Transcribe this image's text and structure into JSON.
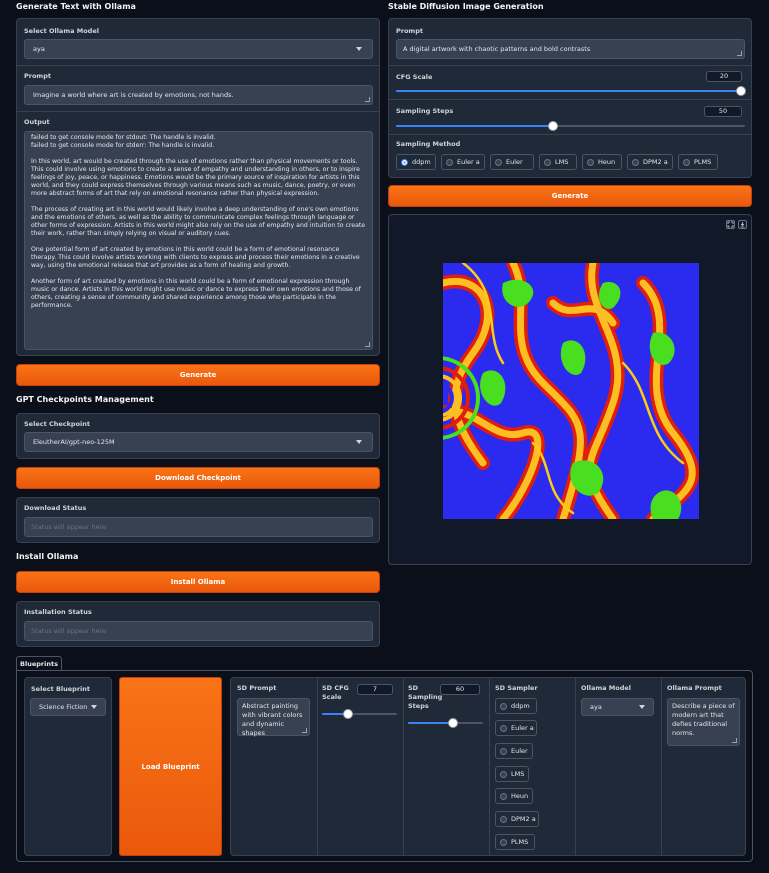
{
  "left": {
    "title": "Generate Text with Ollama",
    "model_label": "Select Ollama Model",
    "model_value": "aya",
    "prompt_label": "Prompt",
    "prompt_value": "Imagine a world where art is created by emotions, not hands.",
    "output_label": "Output",
    "output_text": "failed to get console mode for stdout: The handle is invalid.\nfailed to get console mode for stderr: The handle is invalid.\n\nIn this world, art would be created through the use of emotions rather than physical movements or tools. This could involve using emotions to create a sense of empathy and understanding in others, or to inspire feelings of joy, peace, or happiness. Emotions would be the primary source of inspiration for artists in this world, and they could express themselves through various means such as music, dance, poetry, or even more abstract forms of art that rely on emotional resonance rather than physical expression.\n\nThe process of creating art in this world would likely involve a deep understanding of one's own emotions and the emotions of others, as well as the ability to communicate complex feelings through language or other forms of expression. Artists in this world might also rely on the use of empathy and intuition to create their work, rather than simply relying on visual or auditory cues.\n\nOne potential form of art created by emotions in this world could be a form of emotional resonance therapy. This could involve artists working with clients to express and process their emotions in a creative way, using the emotional release that art provides as a form of healing and growth.\n\nAnother form of art created by emotions in this world could be a form of emotional expression through music or dance. Artists in this world might use music or dance to express their own emotions and those of others, creating a sense of community and shared experience among those who participate in the performance.",
    "generate_label": "Generate",
    "ckpt_title": "GPT Checkpoints Management",
    "ckpt_label": "Select Checkpoint",
    "ckpt_value": "EleutherAI/gpt-neo-125M",
    "download_label": "Download Checkpoint",
    "download_status_label": "Download Status",
    "download_status_placeholder": "Status will appear here",
    "install_title": "Install Ollama",
    "install_label": "Install Ollama",
    "install_status_label": "Installation Status",
    "install_status_placeholder": "Status will appear here"
  },
  "right": {
    "title": "Stable Diffusion Image Generation",
    "prompt_label": "Prompt",
    "prompt_value": "A digital artwork with chaotic patterns and bold contrasts",
    "cfg_label": "CFG Scale",
    "cfg_value": "20",
    "cfg_fraction": 1.0,
    "steps_label": "Sampling Steps",
    "steps_value": "50",
    "steps_fraction": 0.45,
    "method_label": "Sampling Method",
    "methods": [
      "ddpm",
      "Euler a",
      "Euler",
      "LMS",
      "Heun",
      "DPM2 a",
      "PLMS"
    ],
    "selected_method": "ddpm",
    "generate_label": "Generate"
  },
  "blueprints": {
    "tab_label": "Blueprints",
    "select_label": "Select Blueprint",
    "select_value": "Science Fiction",
    "load_label": "Load Blueprint",
    "sd_prompt_label": "SD Prompt",
    "sd_prompt_value": "Abstract painting with vibrant colors and dynamic shapes",
    "cfg_label": "SD CFG Scale",
    "cfg_value": "7",
    "cfg_fraction": 0.35,
    "steps_label": "SD Sampling Steps",
    "steps_value": "60",
    "steps_fraction": 0.6,
    "sampler_label": "SD Sampler",
    "samplers": [
      "ddpm",
      "Euler a",
      "Euler",
      "LMS",
      "Heun",
      "DPM2 a",
      "PLMS"
    ],
    "ollama_model_label": "Ollama Model",
    "ollama_model_value": "aya",
    "ollama_prompt_label": "Ollama Prompt",
    "ollama_prompt_value": "Describe a piece of modern art that defies traditional norms."
  },
  "colors": {
    "accent": "#f97316",
    "background": "#0b0f19",
    "panel": "#1f2937",
    "radio_on": "#3b82f6"
  },
  "icons": [
    "chevron-down-icon",
    "fullscreen-icon",
    "download-icon"
  ]
}
